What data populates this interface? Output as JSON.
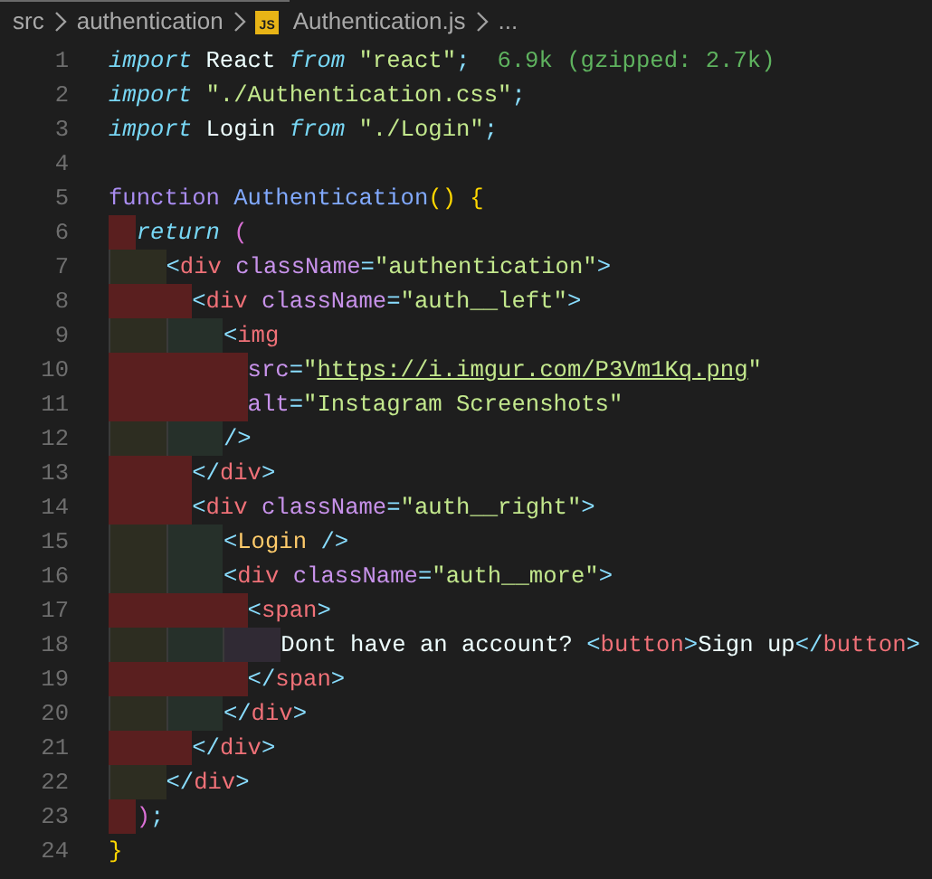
{
  "breadcrumb": [
    {
      "kind": "folder",
      "text": "src"
    },
    {
      "kind": "folder",
      "text": "authentication"
    },
    {
      "kind": "js-file",
      "text": "Authentication.js",
      "icon_text": "JS"
    },
    {
      "kind": "more",
      "text": "..."
    }
  ],
  "lines": [
    {
      "number": "1",
      "tokens": [
        {
          "kind": "keyword",
          "text": "import"
        },
        {
          "kind": "plain",
          "text": " React "
        },
        {
          "kind": "keyword",
          "text": "from"
        },
        {
          "kind": "string",
          "text": " \"react\""
        },
        {
          "kind": "punct",
          "text": ";"
        }
      ],
      "size_hint": "6.9k (gzipped: 2.7k)"
    },
    {
      "number": "2",
      "tokens": [
        {
          "kind": "keyword",
          "text": "import"
        },
        {
          "kind": "string",
          "text": " \"./Authentication.css\""
        },
        {
          "kind": "punct",
          "text": ";"
        }
      ]
    },
    {
      "number": "3",
      "tokens": [
        {
          "kind": "keyword",
          "text": "import"
        },
        {
          "kind": "plain",
          "text": " Login "
        },
        {
          "kind": "keyword",
          "text": "from"
        },
        {
          "kind": "string",
          "text": " \"./Login\""
        },
        {
          "kind": "punct",
          "text": ";"
        }
      ]
    },
    {
      "number": "4"
    },
    {
      "number": "5",
      "tokens": [
        {
          "kind": "storage",
          "text": "function"
        },
        {
          "kind": "func",
          "text": " Authentication"
        },
        {
          "kind": "bracket",
          "text": "()"
        },
        {
          "kind": "bracket",
          "text": " {"
        }
      ]
    },
    {
      "number": "6",
      "tokens": [
        {
          "kind": "keyword",
          "text": "  return"
        },
        {
          "kind": "bracket2",
          "text": " ("
        }
      ]
    },
    {
      "number": "7",
      "tokens": [
        {
          "kind": "tag",
          "text": "    <"
        },
        {
          "kind": "tagname",
          "text": "div"
        },
        {
          "kind": "attr",
          "text": " className"
        },
        {
          "kind": "op",
          "text": "="
        },
        {
          "kind": "string",
          "text": "\"authentication\""
        },
        {
          "kind": "tag",
          "text": ">"
        }
      ]
    },
    {
      "number": "8",
      "tokens": [
        {
          "kind": "tag",
          "text": "      <"
        },
        {
          "kind": "tagname",
          "text": "div"
        },
        {
          "kind": "attr",
          "text": " className"
        },
        {
          "kind": "op",
          "text": "="
        },
        {
          "kind": "string",
          "text": "\"auth__left\""
        },
        {
          "kind": "tag",
          "text": ">"
        }
      ]
    },
    {
      "number": "9",
      "tokens": [
        {
          "kind": "tag",
          "text": "        <"
        },
        {
          "kind": "tagname",
          "text": "img"
        }
      ]
    },
    {
      "number": "10",
      "tokens": [
        {
          "kind": "attr",
          "text": "          src"
        },
        {
          "kind": "op",
          "text": "="
        },
        {
          "kind": "string",
          "text": "\""
        },
        {
          "kind": "url",
          "text": "https://i.imgur.com/P3Vm1Kq.png"
        },
        {
          "kind": "string",
          "text": "\""
        }
      ]
    },
    {
      "number": "11",
      "tokens": [
        {
          "kind": "attr",
          "text": "          alt"
        },
        {
          "kind": "op",
          "text": "="
        },
        {
          "kind": "string",
          "text": "\"Instagram Screenshots\""
        }
      ]
    },
    {
      "number": "12",
      "tokens": [
        {
          "kind": "tag",
          "text": "        />"
        }
      ]
    },
    {
      "number": "13",
      "tokens": [
        {
          "kind": "tag",
          "text": "      </"
        },
        {
          "kind": "tagname",
          "text": "div"
        },
        {
          "kind": "tag",
          "text": ">"
        }
      ]
    },
    {
      "number": "14",
      "tokens": [
        {
          "kind": "tag",
          "text": "      <"
        },
        {
          "kind": "tagname",
          "text": "div"
        },
        {
          "kind": "attr",
          "text": " className"
        },
        {
          "kind": "op",
          "text": "="
        },
        {
          "kind": "string",
          "text": "\"auth__right\""
        },
        {
          "kind": "tag",
          "text": ">"
        }
      ]
    },
    {
      "number": "15",
      "tokens": [
        {
          "kind": "tag",
          "text": "        <"
        },
        {
          "kind": "component",
          "text": "Login"
        },
        {
          "kind": "tag",
          "text": " />"
        }
      ]
    },
    {
      "number": "16",
      "tokens": [
        {
          "kind": "tag",
          "text": "        <"
        },
        {
          "kind": "tagname",
          "text": "div"
        },
        {
          "kind": "attr",
          "text": " className"
        },
        {
          "kind": "op",
          "text": "="
        },
        {
          "kind": "string",
          "text": "\"auth__more\""
        },
        {
          "kind": "tag",
          "text": ">"
        }
      ]
    },
    {
      "number": "17",
      "tokens": [
        {
          "kind": "tag",
          "text": "          <"
        },
        {
          "kind": "tagname",
          "text": "span"
        },
        {
          "kind": "tag",
          "text": ">"
        }
      ]
    },
    {
      "number": "18",
      "tokens": [
        {
          "kind": "plain",
          "text": "            Dont have an account? "
        },
        {
          "kind": "tag",
          "text": "<"
        },
        {
          "kind": "tagname",
          "text": "button"
        },
        {
          "kind": "tag",
          "text": ">"
        },
        {
          "kind": "plain",
          "text": "Sign up"
        },
        {
          "kind": "tag",
          "text": "</"
        },
        {
          "kind": "tagname",
          "text": "button"
        },
        {
          "kind": "tag",
          "text": ">"
        }
      ]
    },
    {
      "number": "19",
      "tokens": [
        {
          "kind": "tag",
          "text": "          </"
        },
        {
          "kind": "tagname",
          "text": "span"
        },
        {
          "kind": "tag",
          "text": ">"
        }
      ]
    },
    {
      "number": "20",
      "tokens": [
        {
          "kind": "tag",
          "text": "        </"
        },
        {
          "kind": "tagname",
          "text": "div"
        },
        {
          "kind": "tag",
          "text": ">"
        }
      ]
    },
    {
      "number": "21",
      "tokens": [
        {
          "kind": "tag",
          "text": "      </"
        },
        {
          "kind": "tagname",
          "text": "div"
        },
        {
          "kind": "tag",
          "text": ">"
        }
      ]
    },
    {
      "number": "22",
      "tokens": [
        {
          "kind": "tag",
          "text": "    </"
        },
        {
          "kind": "tagname",
          "text": "div"
        },
        {
          "kind": "tag",
          "text": ">"
        }
      ]
    },
    {
      "number": "23",
      "tokens": [
        {
          "kind": "bracket2",
          "text": "  )"
        },
        {
          "kind": "punct",
          "text": ";"
        }
      ]
    },
    {
      "number": "24",
      "tokens": [
        {
          "kind": "bracket",
          "text": "}"
        }
      ]
    }
  ]
}
